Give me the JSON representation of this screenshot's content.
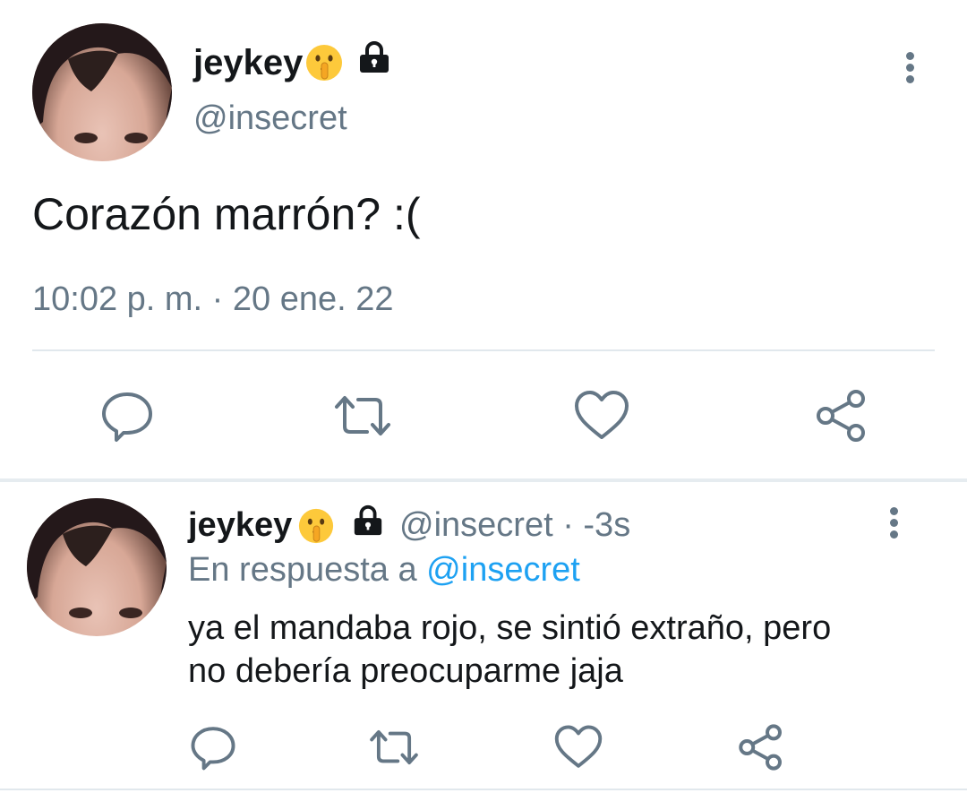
{
  "main_tweet": {
    "display_name": "jeykey",
    "handle": "@insecret",
    "text": "Corazón marrón? :(",
    "timestamp": "10:02 p. m. · 20 ene. 22"
  },
  "reply": {
    "display_name": "jeykey",
    "handle_time": "@insecret · -3s",
    "reply_prefix": "En respuesta a",
    "reply_to": "@insecret",
    "text_line1": "ya el mandaba rojo, se sintió extraño, pero",
    "text_line2": "no debería preocuparme jaja"
  },
  "colors": {
    "text": "#14171a",
    "muted": "#657786",
    "link": "#1da1f2",
    "divider": "#e1e8ed"
  },
  "icons": [
    "shushing-face-emoji",
    "lock-icon",
    "more-options-icon",
    "reply-icon",
    "retweet-icon",
    "like-icon",
    "share-icon"
  ]
}
